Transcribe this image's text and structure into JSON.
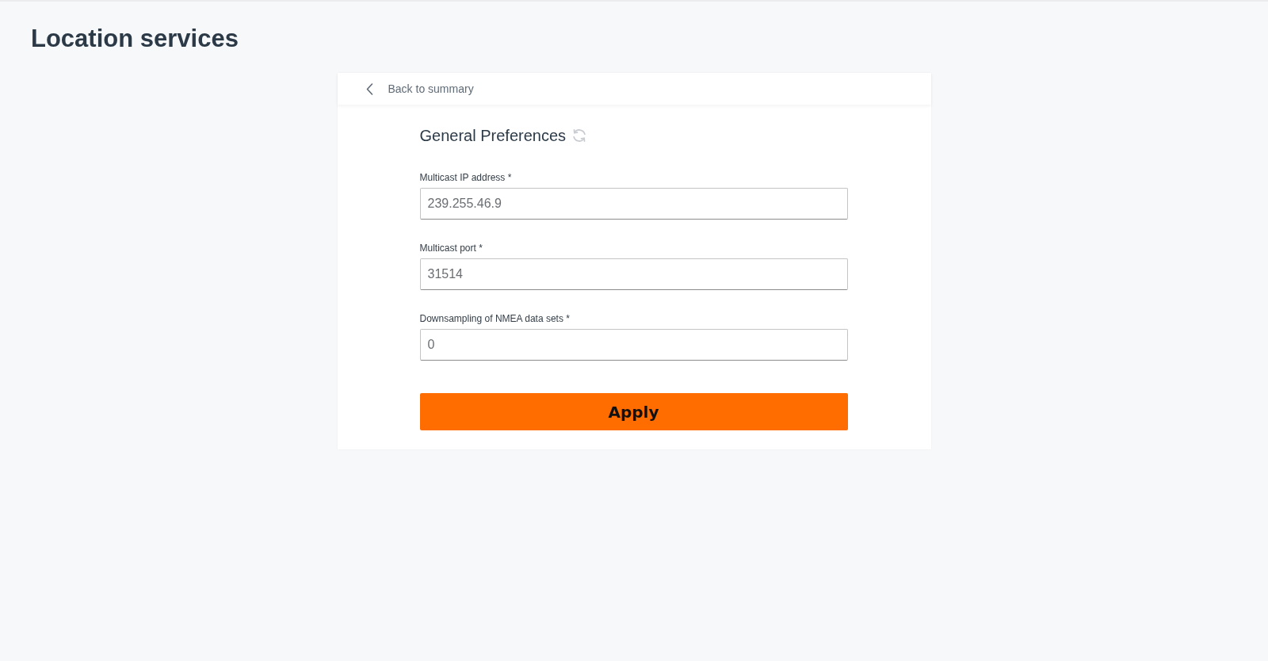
{
  "page": {
    "title": "Location services"
  },
  "back_link": {
    "label": "Back to summary"
  },
  "section": {
    "title": "General Preferences"
  },
  "fields": [
    {
      "label": "Multicast IP address *",
      "value": "239.255.46.9"
    },
    {
      "label": "Multicast port *",
      "value": "31514"
    },
    {
      "label": "Downsampling of NMEA data sets *",
      "value": "0"
    }
  ],
  "apply_button": {
    "label": "Apply"
  }
}
